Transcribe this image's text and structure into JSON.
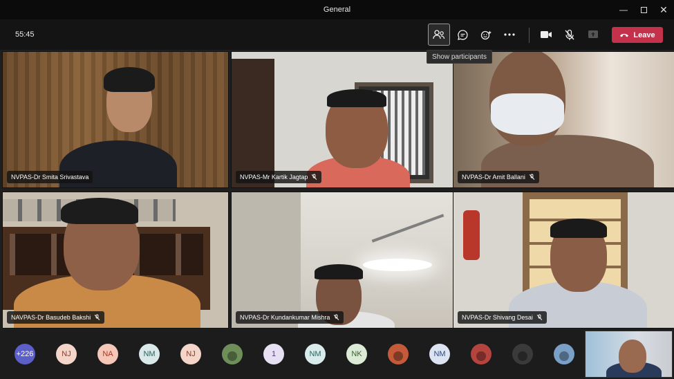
{
  "window": {
    "title": "General"
  },
  "toolbar": {
    "timer": "55:45",
    "buttons": [
      {
        "name": "participants",
        "icon": "participants-icon",
        "active": true
      },
      {
        "name": "chat",
        "icon": "chat-icon"
      },
      {
        "name": "reactions",
        "icon": "reactions-icon"
      },
      {
        "name": "more",
        "icon": "more-icon"
      },
      {
        "name": "camera",
        "icon": "camera-icon"
      },
      {
        "name": "mic",
        "icon": "mic-off-icon"
      },
      {
        "name": "share",
        "icon": "share-icon"
      }
    ],
    "leave_label": "Leave",
    "tooltip": "Show participants"
  },
  "tiles": [
    {
      "name": "NVPAS-Dr Smita Srivastava",
      "muted": false
    },
    {
      "name": "NVPAS-Mr Kartik Jagtap",
      "muted": true
    },
    {
      "name": "NVPAS-Dr Amit Ballani",
      "muted": true
    },
    {
      "name": "NAVPAS-Dr Basudeb Bakshi",
      "muted": true
    },
    {
      "name": "NVPAS-Dr Kundankumar Mishra",
      "muted": true
    },
    {
      "name": "NVPAS-Dr Shivang Desai",
      "muted": true
    }
  ],
  "strip": {
    "overflow": "+226",
    "avatars": [
      {
        "initials": "NJ",
        "bg": "#f3d6c9",
        "fg": "#8a3a2a"
      },
      {
        "initials": "NA",
        "bg": "#f4c7b8",
        "fg": "#a8361f"
      },
      {
        "initials": "NM",
        "bg": "#d9e8e8",
        "fg": "#2f5f5f"
      },
      {
        "initials": "NJ",
        "bg": "#f3d6c9",
        "fg": "#8a3a2a"
      },
      {
        "initials": "",
        "photo": true,
        "bg": "#6f8f5a"
      },
      {
        "initials": "1",
        "bg": "#e6e0f2",
        "fg": "#4d3b7a"
      },
      {
        "initials": "NM",
        "bg": "#d9ecec",
        "fg": "#2f6060"
      },
      {
        "initials": "NK",
        "bg": "#dcebd6",
        "fg": "#36632c"
      },
      {
        "initials": "",
        "photo": true,
        "bg": "#c45a3a"
      },
      {
        "initials": "NM",
        "bg": "#dce4f2",
        "fg": "#2f4a7a"
      },
      {
        "initials": "",
        "photo": true,
        "bg": "#b5443f"
      },
      {
        "initials": "",
        "photo": true,
        "bg": "#3a3a3a"
      },
      {
        "initials": "",
        "photo": true,
        "bg": "#7aa0c8"
      }
    ]
  }
}
